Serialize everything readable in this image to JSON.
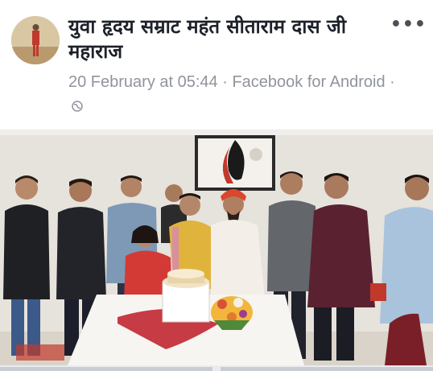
{
  "post": {
    "author_name": "युवा हृदय सम्राट महंत सीताराम दास जी महाराज",
    "timestamp": "20 February at 05:44",
    "separator": " · ",
    "source": "Facebook for Android",
    "trailing_separator": " ·",
    "more_label": "•••"
  },
  "icons": {
    "privacy": "globe-icon",
    "more": "more-options-icon"
  },
  "colors": {
    "name_text": "#1d2129",
    "meta_text": "#90949c",
    "background": "#e9ebee"
  }
}
